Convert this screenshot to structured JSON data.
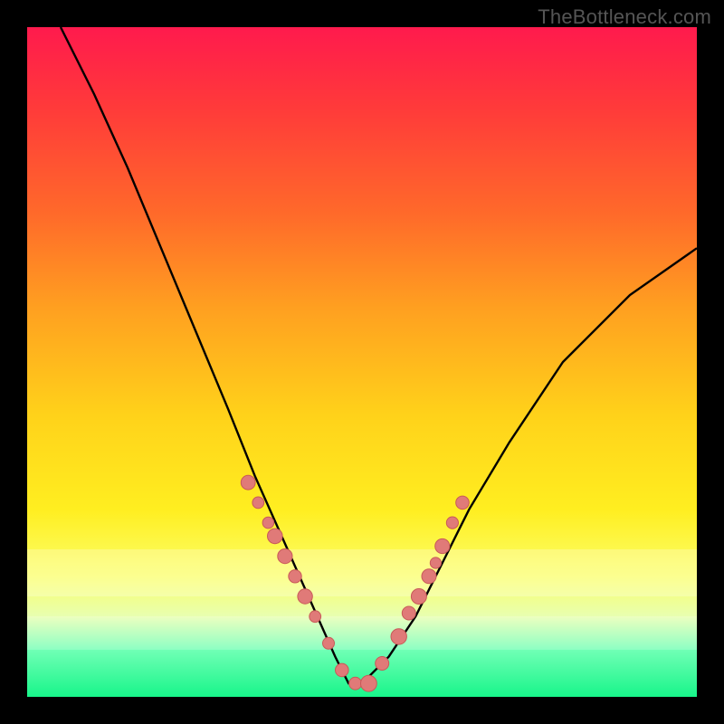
{
  "attribution": "TheBottleneck.com",
  "colors": {
    "page_bg": "#000000",
    "gradient_top": "#ff1a4d",
    "gradient_bottom": "#18f58a",
    "curve_stroke": "#000000",
    "marker_fill": "#e07a78",
    "marker_stroke": "#c85a58"
  },
  "chart_data": {
    "type": "line",
    "title": "",
    "xlabel": "",
    "ylabel": "",
    "xlim": [
      0,
      100
    ],
    "ylim": [
      0,
      100
    ],
    "note": "x and y are percent of plot width/height; y=0 is the green minimum, y=100 is the red top. Curve is a V with minimum near x≈48.",
    "series": [
      {
        "name": "bottleneck-curve",
        "x": [
          5,
          10,
          15,
          20,
          25,
          30,
          34,
          38,
          42,
          46,
          48,
          50,
          54,
          58,
          62,
          66,
          72,
          80,
          90,
          100
        ],
        "y": [
          100,
          90,
          79,
          67,
          55,
          43,
          33,
          24,
          15,
          6,
          2,
          2,
          6,
          12,
          20,
          28,
          38,
          50,
          60,
          67
        ]
      }
    ],
    "markers": {
      "name": "highlighted-points",
      "note": "salmon dots clustered near the trough and partway up each arm",
      "x": [
        33,
        34.5,
        36,
        37,
        38.5,
        40,
        41.5,
        43,
        45,
        47,
        49,
        51,
        53,
        55.5,
        57,
        58.5,
        60,
        61,
        62,
        63.5,
        65
      ],
      "y": [
        32,
        29,
        26,
        24,
        21,
        18,
        15,
        12,
        8,
        4,
        2,
        2,
        5,
        9,
        12.5,
        15,
        18,
        20,
        22.5,
        26,
        29
      ]
    },
    "bands": [
      {
        "name": "pale-band-upper",
        "y_from": 78,
        "y_to": 85,
        "opacity": 0.25
      },
      {
        "name": "pale-band-lower",
        "y_from": 88,
        "y_to": 93,
        "opacity": 0.2
      }
    ]
  }
}
